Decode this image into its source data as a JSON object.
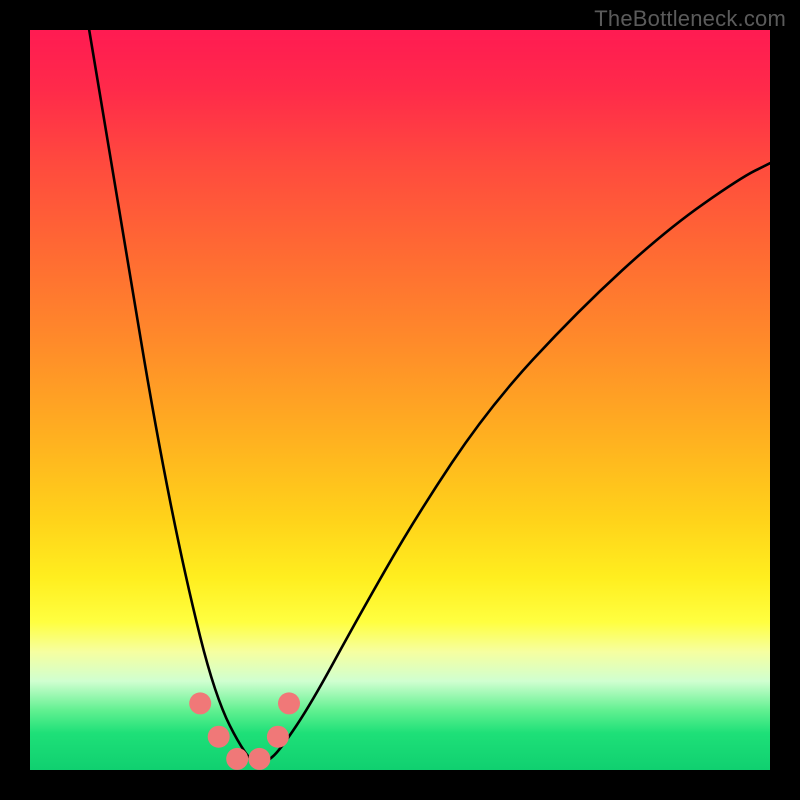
{
  "watermark": "TheBottleneck.com",
  "chart_data": {
    "type": "line",
    "title": "",
    "xlabel": "",
    "ylabel": "",
    "xlim": [
      0,
      100
    ],
    "ylim": [
      0,
      100
    ],
    "grid": false,
    "legend": false,
    "series": [
      {
        "name": "main-curve",
        "color": "#000000",
        "x": [
          8,
          10,
          12,
          14,
          16,
          18,
          20,
          22,
          24,
          26,
          28,
          30,
          32,
          34,
          38,
          44,
          52,
          62,
          74,
          86,
          96,
          100
        ],
        "y": [
          100,
          88,
          76,
          64,
          52,
          41,
          31,
          22,
          14,
          8,
          4,
          1,
          1,
          3,
          9,
          20,
          34,
          49,
          62,
          73,
          80,
          82
        ]
      },
      {
        "name": "marker-dots",
        "color": "#f07878",
        "type": "scatter",
        "x": [
          23,
          25.5,
          28,
          31,
          33.5,
          35
        ],
        "y": [
          9,
          4.5,
          1.5,
          1.5,
          4.5,
          9
        ]
      }
    ],
    "annotations": []
  }
}
